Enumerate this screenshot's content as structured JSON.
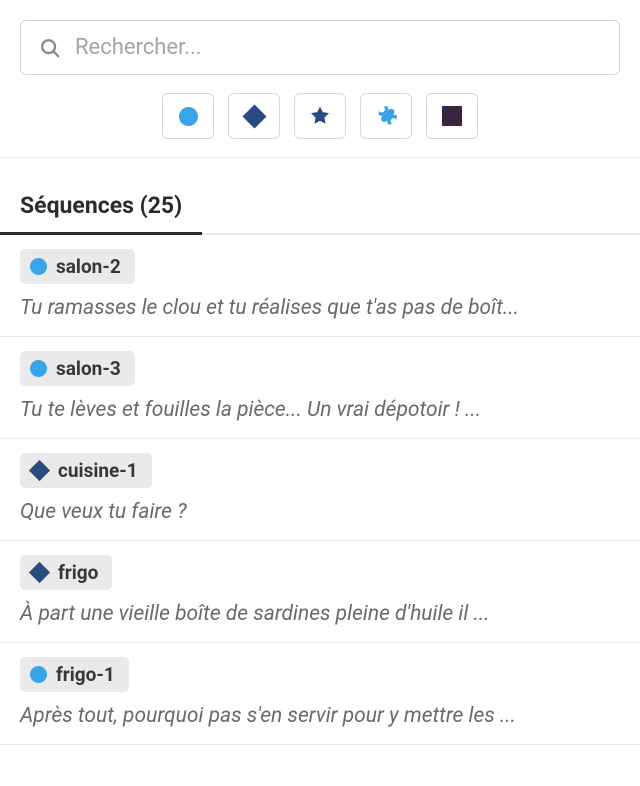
{
  "search": {
    "placeholder": "Rechercher..."
  },
  "filters": [
    {
      "shape": "circle",
      "name": "filter-circle"
    },
    {
      "shape": "diamond",
      "name": "filter-diamond"
    },
    {
      "shape": "star",
      "name": "filter-star"
    },
    {
      "shape": "puzzle",
      "name": "filter-puzzle"
    },
    {
      "shape": "square",
      "name": "filter-square"
    }
  ],
  "colors": {
    "circle": "#3aa4e8",
    "diamond": "#2a4b82",
    "star": "#2a4b82",
    "puzzle": "#3aa4e8",
    "square": "#3b2442"
  },
  "tab": {
    "label": "Séquences (25)"
  },
  "items": [
    {
      "shape": "circle",
      "tag": "salon-2",
      "preview": "Tu ramasses le clou et tu réalises que t'as pas de boît..."
    },
    {
      "shape": "circle",
      "tag": "salon-3",
      "preview": "Tu te lèves et fouilles la pièce... Un vrai dépotoir ! ..."
    },
    {
      "shape": "diamond",
      "tag": "cuisine-1",
      "preview": "Que veux tu faire ?"
    },
    {
      "shape": "diamond",
      "tag": "frigo",
      "preview": "À part une vieille boîte de sardines pleine d'huile il ..."
    },
    {
      "shape": "circle",
      "tag": "frigo-1",
      "preview": "Après tout, pourquoi pas s'en servir pour y mettre les ..."
    }
  ]
}
